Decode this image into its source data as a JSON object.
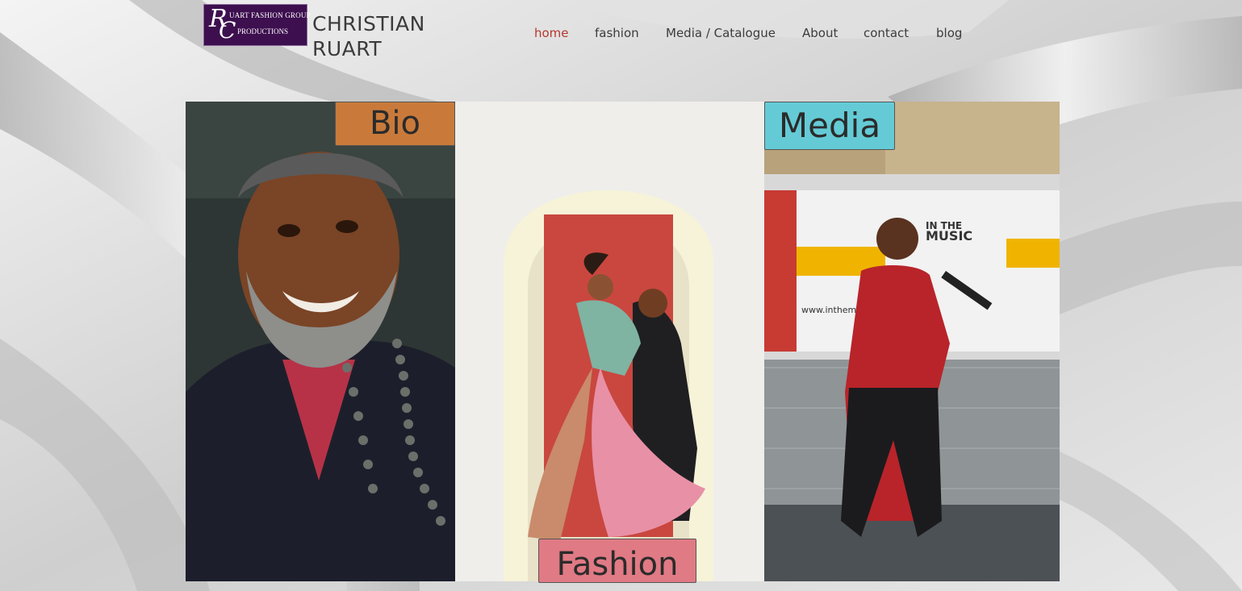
{
  "brand": {
    "logo_line1": "UART FASHION GROUP",
    "logo_line2": "PRODUCTIONS",
    "logo_letters": "RC",
    "site_title_line1": "CHRISTIAN",
    "site_title_line2": "RUART"
  },
  "nav": {
    "items": [
      {
        "label": "home",
        "active": true
      },
      {
        "label": "fashion",
        "active": false
      },
      {
        "label": "Media / Catalogue",
        "active": false
      },
      {
        "label": "About",
        "active": false
      },
      {
        "label": "contact",
        "active": false
      },
      {
        "label": "blog",
        "active": false
      }
    ]
  },
  "panels": {
    "bio": {
      "label": "Bio"
    },
    "fashion": {
      "label": "Fashion"
    },
    "media": {
      "label": "Media"
    }
  },
  "photo_signage": {
    "banner_top": "IN THE",
    "banner_main": "MUSIC",
    "banner_url": "www.inthemusic"
  },
  "colors": {
    "nav_active": "#b5382e",
    "bio_badge": "#c97a3a",
    "media_badge": "#64cbd6",
    "fashion_badge": "#e07a84",
    "logo_bg": "#3d0f4f"
  }
}
